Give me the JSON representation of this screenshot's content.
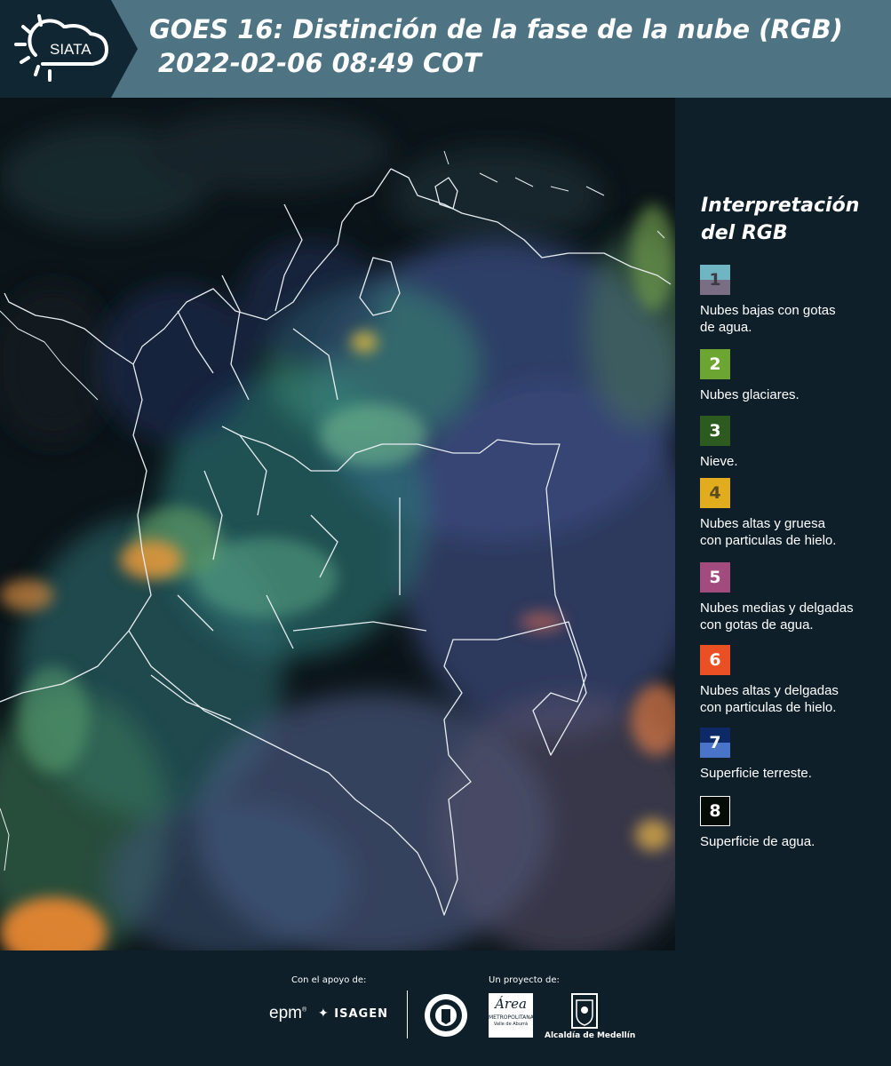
{
  "header": {
    "logo_text": "SIATA",
    "title": "GOES 16: Distinción de la fase de la nube (RGB)",
    "datetime": "2022-02-06 08:49 COT"
  },
  "legend": {
    "title_line1": "Interpretación",
    "title_line2": "del RGB",
    "items": [
      {
        "number": "1",
        "description_line1": "Nubes bajas con gotas",
        "description_line2": "de agua.",
        "color_top": "#70b6c2",
        "color_bottom": "#7a6e84",
        "number_color": "#3b3b45"
      },
      {
        "number": "2",
        "description_line1": "Nubes glaciares.",
        "description_line2": "",
        "color_top": "#6ca531",
        "color_bottom": "#6ca531",
        "number_color": "#ffffff"
      },
      {
        "number": "3",
        "description_line1": "Nieve.",
        "description_line2": "",
        "color_top": "#2c5a1f",
        "color_bottom": "#2c5a1f",
        "number_color": "#ffffff"
      },
      {
        "number": "4",
        "description_line1": "Nubes altas y gruesa",
        "description_line2": "con particulas de hielo.",
        "color_top": "#e1ad1f",
        "color_bottom": "#e1ad1f",
        "number_color": "#5a4a20"
      },
      {
        "number": "5",
        "description_line1": "Nubes medias y delgadas",
        "description_line2": "con gotas de agua.",
        "color_top": "#a14b7e",
        "color_bottom": "#a14b7e",
        "number_color": "#ffffff"
      },
      {
        "number": "6",
        "description_line1": "Nubes altas y delgadas",
        "description_line2": "con particulas de hielo.",
        "color_top": "#ea5023",
        "color_bottom": "#ea5023",
        "number_color": "#ffffff"
      },
      {
        "number": "7",
        "description_line1": "Superficie terreste.",
        "description_line2": "",
        "color_top": "#0e2a66",
        "color_bottom": "#4a74c8",
        "number_color": "#ffffff"
      },
      {
        "number": "8",
        "description_line1": "Superficie de agua.",
        "description_line2": "",
        "color_top": "#050c08",
        "color_bottom": "#050c08",
        "number_color": "#ffffff"
      }
    ]
  },
  "footer": {
    "support_label": "Con el apoyo de:",
    "project_label": "Un proyecto de:",
    "sponsor_epm": "epm",
    "sponsor_isagen": "ISAGEN",
    "partner_area_line1": "Área",
    "partner_area_line2": "METROPOLITANA",
    "partner_area_line3": "Valle de Aburrá",
    "partner_alcaldia": "Alcaldía de Medellín"
  }
}
